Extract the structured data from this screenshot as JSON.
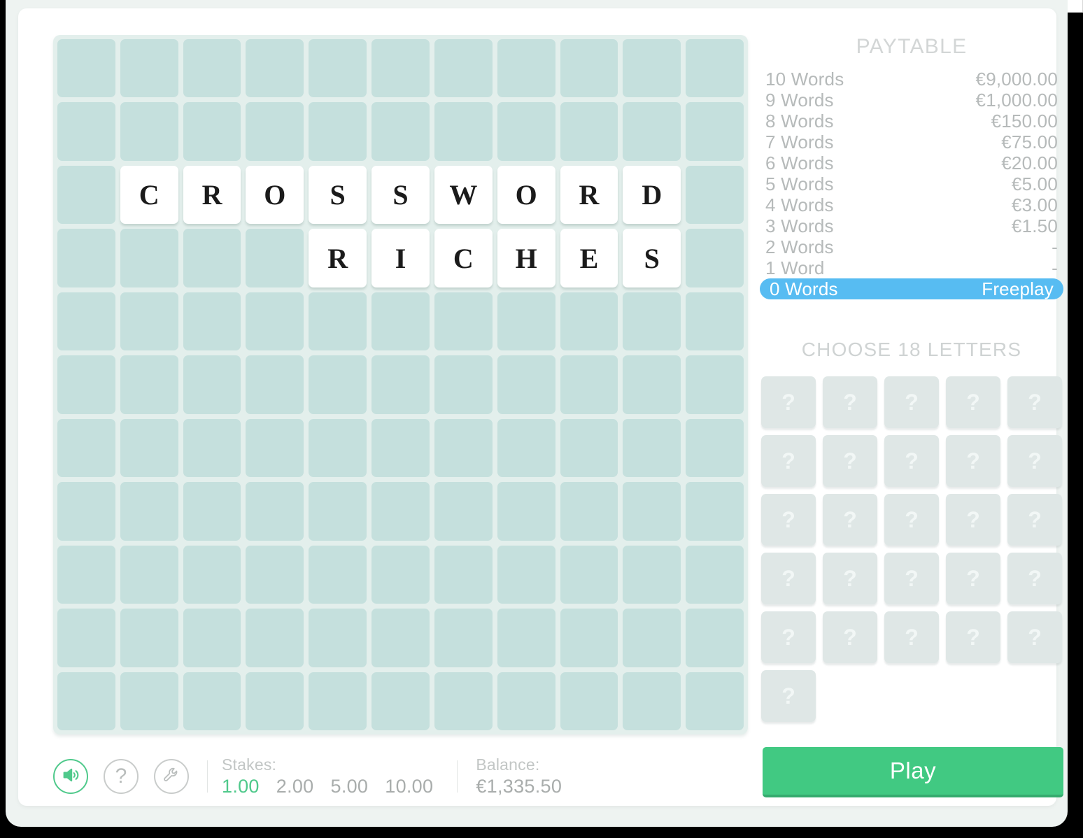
{
  "game": {
    "board": {
      "rows": 11,
      "cols": 11,
      "letters": [
        {
          "row": 3,
          "col": 2,
          "ch": "C"
        },
        {
          "row": 3,
          "col": 3,
          "ch": "R"
        },
        {
          "row": 3,
          "col": 4,
          "ch": "O"
        },
        {
          "row": 3,
          "col": 5,
          "ch": "S"
        },
        {
          "row": 3,
          "col": 6,
          "ch": "S"
        },
        {
          "row": 3,
          "col": 7,
          "ch": "W"
        },
        {
          "row": 3,
          "col": 8,
          "ch": "O"
        },
        {
          "row": 3,
          "col": 9,
          "ch": "R"
        },
        {
          "row": 3,
          "col": 10,
          "ch": "D"
        },
        {
          "row": 4,
          "col": 5,
          "ch": "R"
        },
        {
          "row": 4,
          "col": 6,
          "ch": "I"
        },
        {
          "row": 4,
          "col": 7,
          "ch": "C"
        },
        {
          "row": 4,
          "col": 8,
          "ch": "H"
        },
        {
          "row": 4,
          "col": 9,
          "ch": "E"
        },
        {
          "row": 4,
          "col": 10,
          "ch": "S"
        }
      ],
      "words_shown": [
        "CROSSWORD",
        "RICHES"
      ],
      "cell_color": "#c5e0dd",
      "board_color": "#e3efec"
    },
    "paytable": {
      "title": "PAYTABLE",
      "rows": [
        {
          "label": "10 Words",
          "value": "€9,000.00",
          "highlight": false
        },
        {
          "label": "9 Words",
          "value": "€1,000.00",
          "highlight": false
        },
        {
          "label": "8 Words",
          "value": "€150.00",
          "highlight": false
        },
        {
          "label": "7 Words",
          "value": "€75.00",
          "highlight": false
        },
        {
          "label": "6 Words",
          "value": "€20.00",
          "highlight": false
        },
        {
          "label": "5 Words",
          "value": "€5.00",
          "highlight": false
        },
        {
          "label": "4 Words",
          "value": "€3.00",
          "highlight": false
        },
        {
          "label": "3 Words",
          "value": "€1.50",
          "highlight": false
        },
        {
          "label": "2 Words",
          "value": "-",
          "highlight": false
        },
        {
          "label": "1 Word",
          "value": "-",
          "highlight": false
        },
        {
          "label": "0 Words",
          "value": "Freeplay",
          "highlight": true
        }
      ],
      "highlight_color": "#57bcf2"
    },
    "letter_pool": {
      "title": "CHOOSE 18 LETTERS",
      "tile_glyph": "?",
      "tile_count": 26,
      "tile_color": "#dfe7e6"
    },
    "controls": {
      "sound_icon": "speaker-on-icon",
      "sound_active": true,
      "help_icon": "question-mark-icon",
      "settings_icon": "wrench-icon",
      "accent_color": "#4fc98b"
    },
    "stakes": {
      "label": "Stakes:",
      "options": [
        "1.00",
        "2.00",
        "5.00",
        "10.00"
      ],
      "selected": "1.00"
    },
    "balance": {
      "label": "Balance:",
      "value": "€1,335.50"
    },
    "play": {
      "label": "Play",
      "color": "#41c982"
    }
  }
}
